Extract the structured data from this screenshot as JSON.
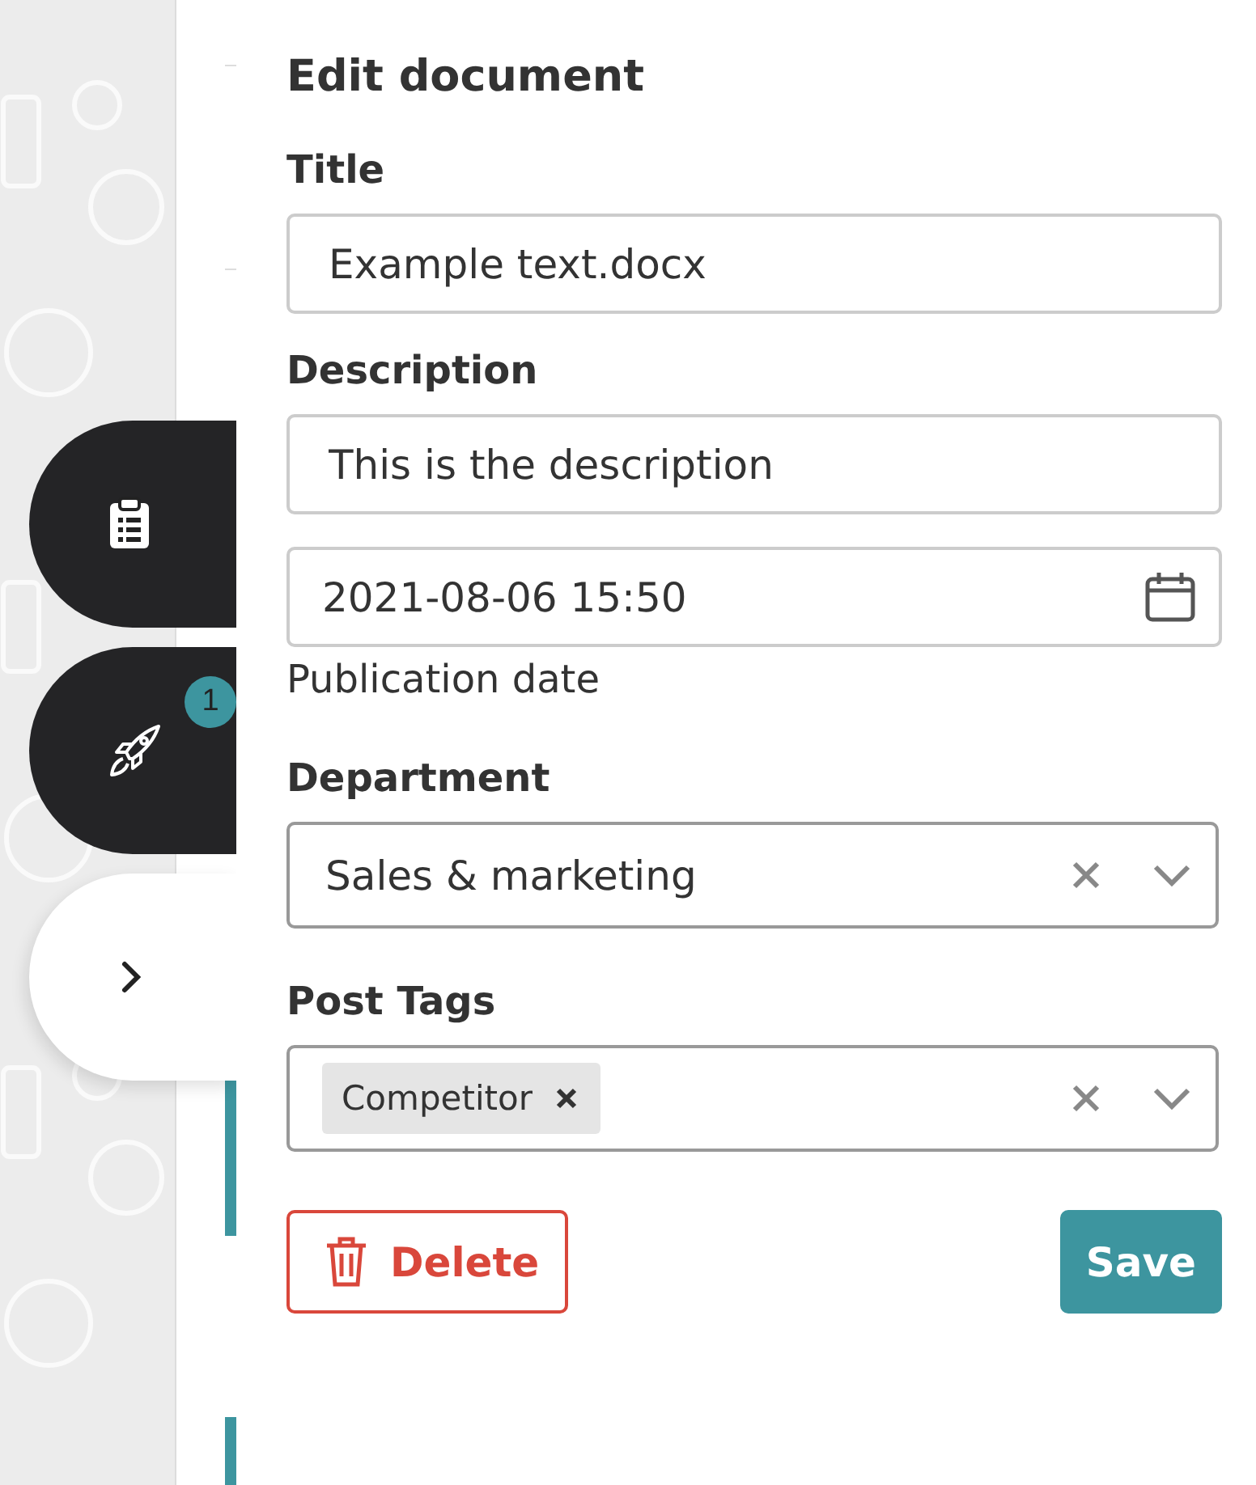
{
  "side_tabs": [
    {
      "kind": "list",
      "selected": false
    },
    {
      "kind": "rocket",
      "selected": false,
      "badge": "1"
    },
    {
      "kind": "chevron",
      "selected": true
    }
  ],
  "panel": {
    "title": "Edit document",
    "title_field": {
      "label": "Title",
      "value": "Example text.docx"
    },
    "description_field": {
      "label": "Description",
      "value": "This is the description"
    },
    "date_field": {
      "value": "2021-08-06 15:50",
      "hint": "Publication date"
    },
    "department": {
      "label": "Department",
      "value": "Sales & marketing"
    },
    "post_tags": {
      "label": "Post Tags",
      "tags": [
        "Competitor"
      ]
    },
    "buttons": {
      "delete": "Delete",
      "save": "Save"
    }
  }
}
